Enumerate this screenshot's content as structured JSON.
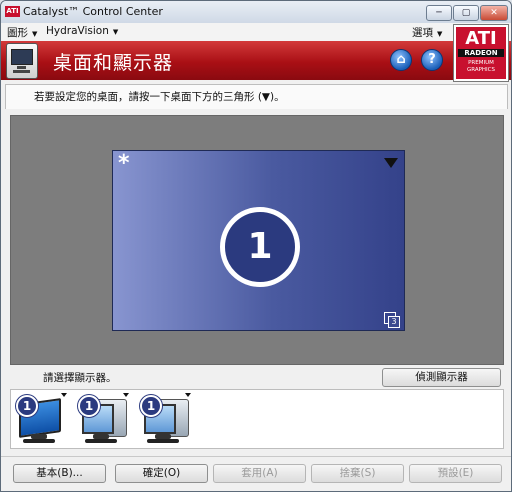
{
  "window": {
    "title": "Catalyst™ Control Center",
    "minimize": "─",
    "maximize": "▢",
    "close": "✕"
  },
  "menubar": {
    "graphics": "圖形",
    "hydravision": "HydraVision",
    "options": "選項"
  },
  "banner": {
    "title": "桌面和顯示器",
    "home_icon": "house-icon",
    "help_icon": "question-icon"
  },
  "logo": {
    "brand": "ATI",
    "product": "RADEON",
    "tagline_line1": "PREMIUM",
    "tagline_line2": "GRAPHICS"
  },
  "instruction": "若要設定您的桌面，請按一下桌面下方的三角形 (▼)。",
  "desktop": {
    "primary_marker": "*",
    "display_number": "1",
    "clone_badge": "3"
  },
  "select_label": "請選擇顯示器。",
  "detect_button": "偵測顯示器",
  "monitors": [
    {
      "number": "1",
      "type": "lcd"
    },
    {
      "number": "1",
      "type": "crt"
    },
    {
      "number": "1",
      "type": "crt"
    }
  ],
  "buttons": {
    "basic": "基本(B)...",
    "ok": "確定(O)",
    "apply": "套用(A)",
    "discard": "捨棄(S)",
    "defaults": "預設(E)"
  }
}
